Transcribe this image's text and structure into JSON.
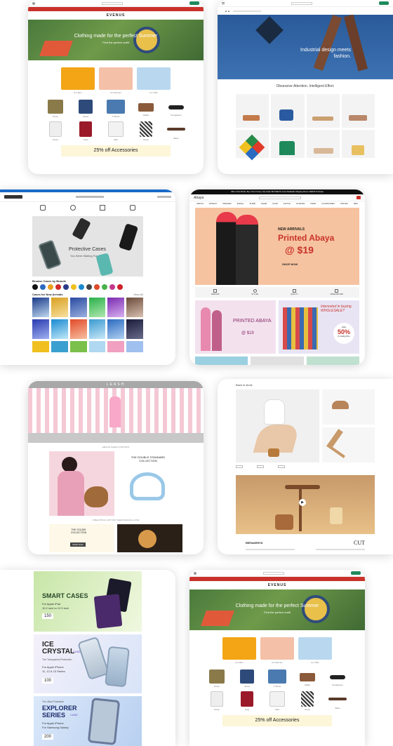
{
  "colors": {
    "evenus_red": "#c8322a",
    "hero_green": "#4a7a3c",
    "hero_blue": "#2a5a9a",
    "accent_green": "#1e8a5c",
    "tile_yellow": "#f0d200",
    "banner_peach": "#f6c3a0",
    "cream": "#fdf6d8"
  },
  "card1": {
    "logo": "EVENUS",
    "hero_title": "Clothing made for the perfect Summer",
    "hero_sub": "Find the perfect outfit",
    "categories": [
      "For Men",
      "For Women",
      "For Kids"
    ],
    "items": [
      "Pants",
      "Jeans",
      "T-Shirts",
      "Wallet",
      "Sunglasses",
      "Dress",
      "Tops",
      "Shirt",
      "Dress",
      "Belts"
    ],
    "banner": "25% off Accessories"
  },
  "card2": {
    "hero_title": "Industrial design meets fashion.",
    "subtitle": "Obsessive Attention. Intelligent Effort."
  },
  "card3": {
    "promo_title": "Protective Cases",
    "promo_sub": "You Were Waiting For",
    "brands_label": "Browse Cases by Brands",
    "arrivals_label": "Cases for New Arrivals",
    "view_all": "View All"
  },
  "card4": {
    "announcement": "Offer of the Month | Buy 3 Get 3 Free | Use Code: BUY3GET3 | Free Worldwide Shipping Above US$150 Purchase",
    "brand": "Abaya",
    "nav": [
      "ABAYAS",
      "MODEST",
      "DRESSES",
      "BURQA",
      "JILBAB",
      "NIQAB",
      "HIJAB",
      "KAFTAN",
      "SCARVES",
      "WRAP",
      "ACCESSORIES",
      "PRAYER",
      "NEW"
    ],
    "new_arrivals": "NEW ARRIVALS",
    "headline": "Printed Abaya",
    "price": "@ $19",
    "shop_now": "SHOP NOW",
    "features": [
      "DESIGNS",
      "STYLES",
      "QUALITY",
      "FREE RETURN"
    ],
    "tile_title": "PRINTED ABAYA",
    "tile_price": "@ $19",
    "wholesale": "Interested in buying WHOLESALE?",
    "discount_pre": "Upto",
    "discount": "50%",
    "discount_post": "On Selling Price"
  },
  "card5": {
    "logo": "LEASH",
    "mid_label": "HEALTH CHECK FOR PETS",
    "collection_title": "THE DOUBLE STANDARD COLLECTION",
    "golden_title": "THE GOLDIE COLLECTION",
    "shop": "SHOP NOW",
    "bottom_label": "A BEAUTIFUL GIFT FOR THEIR MAGICAL LOVE"
  },
  "card6": {
    "header": "Back in stock",
    "brand_left": "REFAKERYS",
    "brand_right": "CUT"
  },
  "card7": {
    "p1": {
      "title": "SMART CASES",
      "for": "For Apple iPad",
      "models": "10.2 inch to 12.9 inch",
      "price": "150"
    },
    "p2": {
      "title": "ICE CRYSTAL",
      "ribbon": "CASE",
      "sub": "The Transparent Protection",
      "for": "For Apple iPhone",
      "models": "11, 12 & 13 Series",
      "price": "100"
    },
    "p3": {
      "pre": "The Ultra Protective",
      "title": "EXPLORER SERIES",
      "ribbon": "CASE",
      "for": "For Apple iPhone",
      "models": "For Samsung Galaxy",
      "price": "200"
    }
  },
  "card8": {
    "logo": "EVENUS",
    "hero_title": "Clothing made for the perfect Summer",
    "hero_sub": "Find the perfect outfit",
    "categories": [
      "For Men",
      "For Women",
      "For Kids"
    ],
    "items": [
      "Pants",
      "Jeans",
      "T-Shirts",
      "Wallet",
      "Sunglasses",
      "Dress",
      "Tops",
      "Shirt",
      "Dress",
      "Belts"
    ],
    "banner": "25% off Accessories"
  }
}
